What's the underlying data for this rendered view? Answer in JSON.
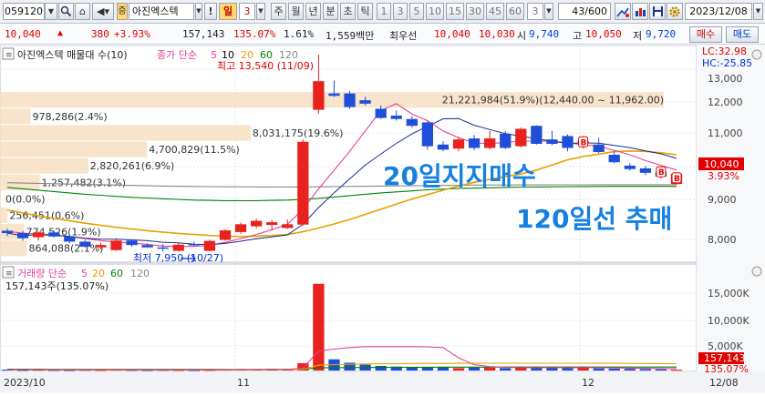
{
  "toolbar": {
    "stock_code": "059120",
    "stock_type_badge": "증",
    "stock_name": "아진엑스텍",
    "exclaim": "!",
    "period_selected": "일",
    "period_num": "3",
    "periods": [
      "주",
      "월",
      "년",
      "분",
      "초",
      "틱"
    ],
    "intervals": [
      "1",
      "3",
      "5",
      "10",
      "15",
      "30",
      "45",
      "60",
      "3"
    ],
    "page_counter": "43/600",
    "date": "2023/12/08"
  },
  "info": {
    "price": "10,040",
    "change": "380",
    "change_pct": "+3.93%",
    "volume": "157,143",
    "volume_ratio": "135.07%",
    "turnover": "1.61%",
    "amount": "1,559백만",
    "best_label": "최우선",
    "ask": "10,040",
    "bid": "10,030",
    "open_label": "시",
    "open": "9,740",
    "high_label": "고",
    "high": "10,050",
    "low_label": "저",
    "low": "9,720",
    "buy_label": "매수",
    "sell_label": "매도"
  },
  "price_panel": {
    "title": "아진엑스텍 매물대 수(10)",
    "ma_label": "종가 단순",
    "ma_periods": [
      "5",
      "10",
      "20",
      "60",
      "120"
    ],
    "ma_colors": [
      "#e0409a",
      "#000000",
      "#e8a000",
      "#008000",
      "#888888"
    ],
    "lc": "LC:32.98",
    "hc": "HC:-25.85",
    "high_marker": "최고 13,540 (11/09)",
    "low_marker": "최저 7,950 (10/27)",
    "current_price_tag": "10,040",
    "current_pct_tag": "3.93%",
    "y_ticks": [
      "13,000",
      "12,000",
      "11,000",
      "10,000",
      "9,000",
      "8,000"
    ],
    "overlay_text_1": "20일지지매수",
    "overlay_text_2": "120일선 추매"
  },
  "volume_profile": [
    {
      "label": "21,221,984(51.9%)(12,440.00 ~ 11,962.00)",
      "share": 0.519
    },
    {
      "label": "978,286(2.4%)",
      "share": 0.024
    },
    {
      "label": "8,031,175(19.6%)",
      "share": 0.196
    },
    {
      "label": "4,700,829(11.5%)",
      "share": 0.115
    },
    {
      "label": "2,820,261(6.9%)",
      "share": 0.069
    },
    {
      "label": "1,257,482(3.1%)",
      "share": 0.031
    },
    {
      "label": "0(0.0%)",
      "share": 0.0
    },
    {
      "label": "256,451(0.6%)",
      "share": 0.006
    },
    {
      "label": "774,526(1.9%)",
      "share": 0.019
    },
    {
      "label": "864,088(2.1%)",
      "share": 0.021
    }
  ],
  "volume_panel": {
    "title": "거래량 단순",
    "ma_periods": [
      "5",
      "20",
      "60",
      "120"
    ],
    "ma_colors": [
      "#e0409a",
      "#e8a000",
      "#008000",
      "#888888"
    ],
    "current": "157,143주(135.07%)",
    "y_ticks": [
      "15,000K",
      "10,000K",
      "5,000K"
    ],
    "current_tag": "157,143",
    "current_pct_tag": "135.07%"
  },
  "x_axis": {
    "labels": [
      "2023/10",
      "11",
      "12"
    ],
    "right_label": "12/08"
  },
  "chart_data": {
    "type": "candlestick",
    "candles": [
      {
        "o": 8370,
        "h": 8430,
        "l": 8210,
        "c": 8300
      },
      {
        "o": 8300,
        "h": 8360,
        "l": 8080,
        "c": 8150
      },
      {
        "o": 8180,
        "h": 8360,
        "l": 8080,
        "c": 8320
      },
      {
        "o": 8320,
        "h": 8380,
        "l": 8170,
        "c": 8200
      },
      {
        "o": 8200,
        "h": 8260,
        "l": 8000,
        "c": 8050
      },
      {
        "o": 8050,
        "h": 8100,
        "l": 7880,
        "c": 7900
      },
      {
        "o": 7880,
        "h": 8020,
        "l": 7820,
        "c": 7950
      },
      {
        "o": 7800,
        "h": 8150,
        "l": 7780,
        "c": 8080
      },
      {
        "o": 8080,
        "h": 8120,
        "l": 7900,
        "c": 7950
      },
      {
        "o": 7950,
        "h": 8000,
        "l": 7870,
        "c": 7880
      },
      {
        "o": 7880,
        "h": 7980,
        "l": 7760,
        "c": 7850
      },
      {
        "o": 7780,
        "h": 8000,
        "l": 7760,
        "c": 7960
      },
      {
        "o": 7980,
        "h": 8050,
        "l": 7920,
        "c": 7940
      },
      {
        "o": 7780,
        "h": 8100,
        "l": 7760,
        "c": 8070
      },
      {
        "o": 8100,
        "h": 8420,
        "l": 8080,
        "c": 8380
      },
      {
        "o": 8330,
        "h": 8610,
        "l": 8280,
        "c": 8560
      },
      {
        "o": 8500,
        "h": 8720,
        "l": 8440,
        "c": 8660
      },
      {
        "o": 8540,
        "h": 8680,
        "l": 8380,
        "c": 8620
      },
      {
        "o": 8450,
        "h": 8700,
        "l": 8420,
        "c": 8560
      },
      {
        "o": 8550,
        "h": 11050,
        "l": 8530,
        "c": 10980
      },
      {
        "o": 11920,
        "h": 13540,
        "l": 11800,
        "c": 12760
      },
      {
        "o": 12400,
        "h": 12780,
        "l": 12300,
        "c": 12330
      },
      {
        "o": 12400,
        "h": 12470,
        "l": 11950,
        "c": 12000
      },
      {
        "o": 12200,
        "h": 12300,
        "l": 12050,
        "c": 12100
      },
      {
        "o": 11950,
        "h": 12050,
        "l": 11650,
        "c": 11680
      },
      {
        "o": 11750,
        "h": 11900,
        "l": 11600,
        "c": 11650
      },
      {
        "o": 11650,
        "h": 11740,
        "l": 11400,
        "c": 11450
      },
      {
        "o": 11550,
        "h": 11600,
        "l": 10750,
        "c": 10850
      },
      {
        "o": 10900,
        "h": 11000,
        "l": 10700,
        "c": 10750
      },
      {
        "o": 10780,
        "h": 11120,
        "l": 10700,
        "c": 11050
      },
      {
        "o": 11080,
        "h": 11180,
        "l": 10740,
        "c": 10800
      },
      {
        "o": 10800,
        "h": 11300,
        "l": 10760,
        "c": 11080
      },
      {
        "o": 11220,
        "h": 11300,
        "l": 10760,
        "c": 10800
      },
      {
        "o": 10850,
        "h": 11400,
        "l": 10820,
        "c": 11360
      },
      {
        "o": 11450,
        "h": 11470,
        "l": 10900,
        "c": 10920
      },
      {
        "o": 11050,
        "h": 11300,
        "l": 10880,
        "c": 10920
      },
      {
        "o": 11150,
        "h": 11200,
        "l": 10700,
        "c": 10800
      },
      {
        "o": 10940,
        "h": 11150,
        "l": 10780,
        "c": 11000
      },
      {
        "o": 10900,
        "h": 11100,
        "l": 10650,
        "c": 10680
      },
      {
        "o": 10600,
        "h": 10700,
        "l": 10350,
        "c": 10380
      },
      {
        "o": 10280,
        "h": 10350,
        "l": 10140,
        "c": 10180
      },
      {
        "o": 10200,
        "h": 10270,
        "l": 10000,
        "c": 10070
      },
      {
        "o": 10100,
        "h": 10180,
        "l": 9900,
        "c": 9960
      },
      {
        "o": 9740,
        "h": 10050,
        "l": 9720,
        "c": 10040
      }
    ],
    "ma5": [
      8350,
      8300,
      8270,
      8240,
      8200,
      8140,
      8080,
      8040,
      8010,
      7970,
      7920,
      7910,
      7910,
      7940,
      8030,
      8140,
      8260,
      8400,
      8560,
      9000,
      9600,
      10150,
      10700,
      11300,
      11900,
      12100,
      11800,
      11600,
      11300,
      11100,
      10950,
      10930,
      10960,
      11000,
      11000,
      11000,
      10950,
      10900,
      10850,
      10730,
      10600,
      10430,
      10290,
      10150
    ],
    "ma20": [
      8980,
      8890,
      8810,
      8730,
      8660,
      8590,
      8530,
      8470,
      8420,
      8370,
      8330,
      8290,
      8260,
      8230,
      8210,
      8200,
      8210,
      8230,
      8260,
      8340,
      8450,
      8570,
      8700,
      8850,
      9000,
      9150,
      9300,
      9430,
      9560,
      9680,
      9790,
      9880,
      9960,
      10030,
      10150,
      10300,
      10450,
      10550,
      10620,
      10690,
      10710,
      10700,
      10660,
      10600
    ],
    "ma60": [
      9640,
      9600,
      9560,
      9520,
      9480,
      9440,
      9410,
      9380,
      9350,
      9330,
      9310,
      9290,
      9270,
      9260,
      9250,
      9250,
      9250,
      9260,
      9270,
      9290,
      9320,
      9360,
      9400,
      9440,
      9480,
      9510,
      9540,
      9570,
      9590,
      9610,
      9620,
      9630,
      9640,
      9650,
      9655,
      9660,
      9665,
      9668,
      9670,
      9672,
      9673,
      9673,
      9672,
      9670
    ],
    "ma120": [
      9780,
      9770,
      9760,
      9750,
      9740,
      9730,
      9720,
      9710,
      9700,
      9690,
      9680,
      9675,
      9670,
      9665,
      9660,
      9658,
      9656,
      9655,
      9655,
      9656,
      9660,
      9665,
      9670,
      9675,
      9680,
      9685,
      9690,
      9695,
      9700,
      9705,
      9710,
      9712,
      9714,
      9715,
      9716,
      9717,
      9718,
      9719,
      9720,
      9720,
      9720,
      9720,
      9720,
      9720
    ],
    "volumes": [
      190,
      120,
      160,
      130,
      110,
      150,
      120,
      170,
      130,
      110,
      140,
      120,
      110,
      130,
      180,
      220,
      250,
      200,
      260,
      1500,
      17800,
      2300,
      1600,
      1200,
      950,
      800,
      700,
      750,
      650,
      500,
      600,
      550,
      500,
      700,
      650,
      600,
      550,
      700,
      450,
      400,
      350,
      300,
      250,
      157
    ],
    "volume_ma5": [
      160,
      150,
      145,
      140,
      140,
      135,
      130,
      140,
      135,
      130,
      135,
      130,
      125,
      125,
      135,
      150,
      170,
      195,
      220,
      490,
      4000,
      4400,
      4700,
      4900,
      4900,
      4900,
      4900,
      4850,
      4700,
      2600,
      1200,
      800,
      650,
      600,
      600,
      600,
      600,
      600,
      590,
      540,
      490,
      450,
      400,
      350
    ],
    "volume_ma20": [
      180,
      178,
      175,
      172,
      170,
      168,
      165,
      163,
      160,
      158,
      156,
      155,
      154,
      153,
      153,
      155,
      158,
      162,
      168,
      230,
      1100,
      1200,
      1280,
      1340,
      1380,
      1410,
      1430,
      1450,
      1460,
      1470,
      1480,
      1490,
      1495,
      1500,
      1500,
      1500,
      1495,
      1490,
      1480,
      1470,
      1460,
      1440,
      1420,
      1400
    ],
    "volume_ma60": [
      260,
      258,
      255,
      252,
      250,
      248,
      246,
      244,
      242,
      240,
      238,
      236,
      235,
      234,
      233,
      233,
      233,
      234,
      236,
      255,
      540,
      575,
      600,
      620,
      640,
      655,
      665,
      675,
      685,
      690,
      695,
      700,
      705,
      708,
      710,
      712,
      714,
      716,
      718,
      718,
      718,
      717,
      716,
      715
    ],
    "price_range": [
      7500,
      13700
    ],
    "volume_range": [
      0,
      18500
    ]
  }
}
